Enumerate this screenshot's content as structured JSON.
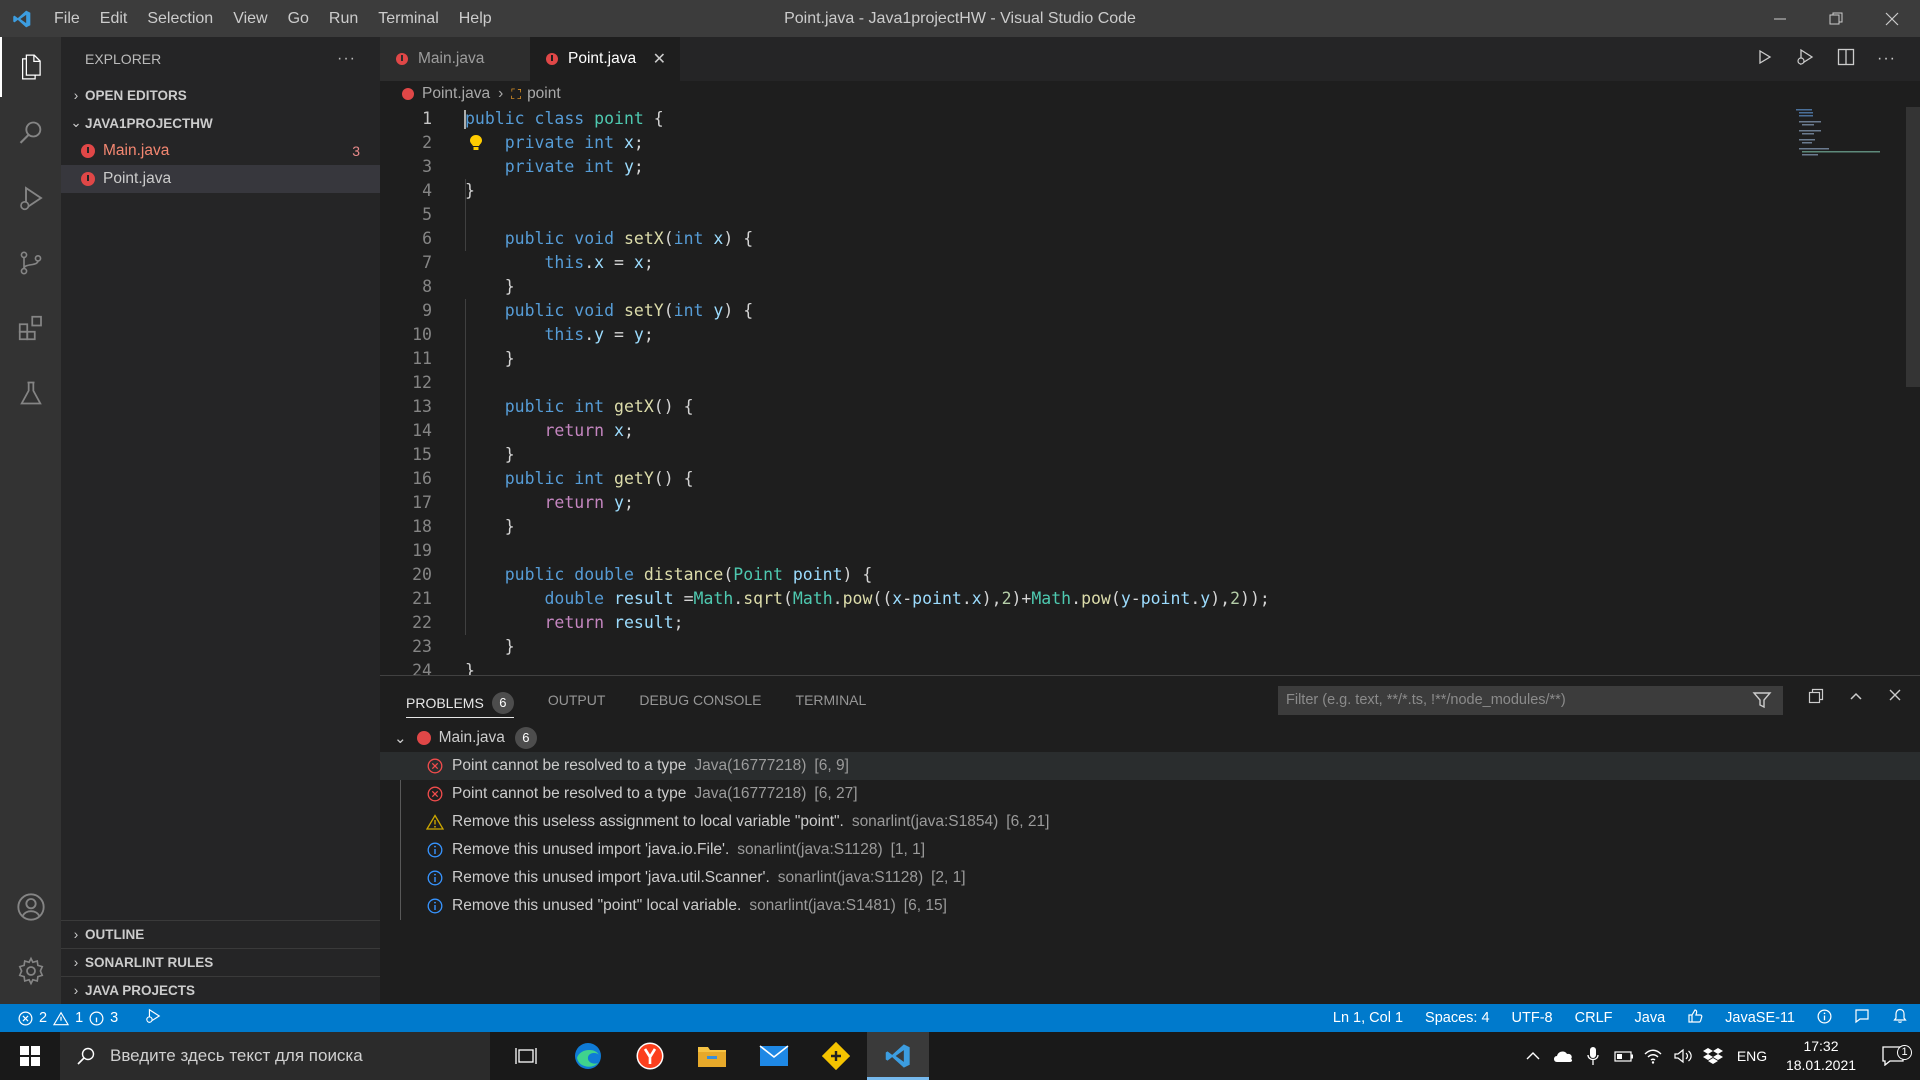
{
  "window": {
    "title": "Point.java - Java1projectHW - Visual Studio Code",
    "menu": [
      "File",
      "Edit",
      "Selection",
      "View",
      "Go",
      "Run",
      "Terminal",
      "Help"
    ]
  },
  "sidebar": {
    "title": "EXPLORER",
    "more": "···",
    "open_editors": "OPEN EDITORS",
    "project": "JAVA1PROJECTHW",
    "files": [
      {
        "name": "Main.java",
        "badge": "3"
      },
      {
        "name": "Point.java",
        "badge": ""
      }
    ],
    "outline": "OUTLINE",
    "sonarlint": "SONARLINT RULES",
    "java_projects": "JAVA PROJECTS"
  },
  "tabs": [
    {
      "label": "Main.java"
    },
    {
      "label": "Point.java",
      "close": "✕"
    }
  ],
  "breadcrumb": {
    "file": "Point.java",
    "symbol": "point"
  },
  "code": {
    "line_numbers": [
      "1",
      "2",
      "3",
      "4",
      "5",
      "6",
      "7",
      "8",
      "9",
      "10",
      "11",
      "12",
      "13",
      "14",
      "15",
      "16",
      "17",
      "18",
      "19",
      "20",
      "21",
      "22",
      "23",
      "24"
    ]
  },
  "panel": {
    "tabs": [
      "PROBLEMS",
      "OUTPUT",
      "DEBUG CONSOLE",
      "TERMINAL"
    ],
    "problems_count": "6",
    "filter_placeholder": "Filter (e.g. text, **/*.ts, !**/node_modules/**)",
    "file": {
      "name": "Main.java",
      "count": "6"
    },
    "problems": [
      {
        "severity": "error",
        "message": "Point cannot be resolved to a type",
        "source": "Java(16777218)",
        "pos": "[6, 9]"
      },
      {
        "severity": "error",
        "message": "Point cannot be resolved to a type",
        "source": "Java(16777218)",
        "pos": "[6, 27]"
      },
      {
        "severity": "warning",
        "message": "Remove this useless assignment to local variable \"point\".",
        "source": "sonarlint(java:S1854)",
        "pos": "[6, 21]"
      },
      {
        "severity": "info",
        "message": "Remove this unused import 'java.io.File'.",
        "source": "sonarlint(java:S1128)",
        "pos": "[1, 1]"
      },
      {
        "severity": "info",
        "message": "Remove this unused import 'java.util.Scanner'.",
        "source": "sonarlint(java:S1128)",
        "pos": "[2, 1]"
      },
      {
        "severity": "info",
        "message": "Remove this unused \"point\" local variable.",
        "source": "sonarlint(java:S1481)",
        "pos": "[6, 15]"
      }
    ]
  },
  "statusbar": {
    "errors": "2",
    "warnings": "1",
    "infos": "3",
    "position": "Ln 1, Col 1",
    "spaces": "Spaces: 4",
    "encoding": "UTF-8",
    "eol": "CRLF",
    "language": "Java",
    "java_version": "JavaSE-11"
  },
  "taskbar": {
    "search_placeholder": "Введите здесь текст для поиска",
    "lang": "ENG",
    "time": "17:32",
    "date": "18.01.2021",
    "notifications": "1"
  },
  "colors": {
    "accent": "#007acc",
    "error": "#f14c4c",
    "warning": "#cca700",
    "info": "#3794ff",
    "java": "#e04747"
  }
}
